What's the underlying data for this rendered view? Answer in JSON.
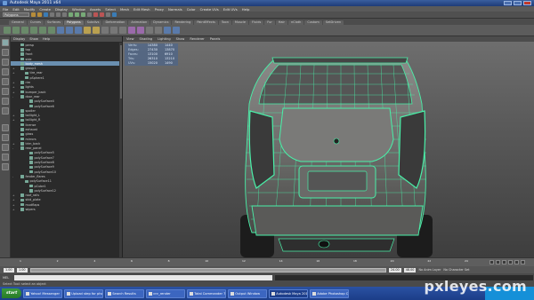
{
  "window": {
    "title": "Autodesk Maya 2011 x64"
  },
  "menubar": {
    "items": [
      "File",
      "Edit",
      "Modify",
      "Create",
      "Display",
      "Window",
      "Assets",
      "Select",
      "Mesh",
      "Edit Mesh",
      "Proxy",
      "Normals",
      "Color",
      "Create UVs",
      "Edit UVs",
      "Help"
    ]
  },
  "statusline": {
    "mode": "Polygons"
  },
  "shelf": {
    "tabs": [
      "General",
      "Curves",
      "Surfaces",
      "Polygons",
      "Subdivs",
      "Deformation",
      "Animation",
      "Dynamics",
      "Rendering",
      "PaintEffects",
      "Toon",
      "Muscle",
      "Fluids",
      "Fur",
      "Hair",
      "nCloth",
      "Custom",
      "SetDriven"
    ],
    "active_tab": 3
  },
  "outliner": {
    "menu": [
      "Display",
      "Show",
      "Help"
    ],
    "rows": [
      {
        "label": "persp",
        "indent": 1,
        "expand": ""
      },
      {
        "label": "top",
        "indent": 1,
        "expand": ""
      },
      {
        "label": "front",
        "indent": 1,
        "expand": ""
      },
      {
        "label": "side",
        "indent": 1,
        "expand": ""
      },
      {
        "label": "body_mesh",
        "indent": 1,
        "expand": "",
        "selected": true
      },
      {
        "label": "group1",
        "indent": 1,
        "expand": "+"
      },
      {
        "label": "tire_rear",
        "indent": 2,
        "expand": "+"
      },
      {
        "label": "pSphere1",
        "indent": 2,
        "expand": ""
      },
      {
        "label": "rim",
        "indent": 1,
        "expand": "+"
      },
      {
        "label": "lights",
        "indent": 1,
        "expand": "+"
      },
      {
        "label": "bumper_back",
        "indent": 1,
        "expand": "+"
      },
      {
        "label": "door_rear",
        "indent": 1,
        "expand": "-"
      },
      {
        "label": "polySurface4",
        "indent": 3,
        "expand": ""
      },
      {
        "label": "polySurface6",
        "indent": 3,
        "expand": ""
      },
      {
        "label": "spoiler",
        "indent": 1,
        "expand": ""
      },
      {
        "label": "taillight_L",
        "indent": 1,
        "expand": "+"
      },
      {
        "label": "taillight_R",
        "indent": 1,
        "expand": "+"
      },
      {
        "label": "license",
        "indent": 1,
        "expand": ""
      },
      {
        "label": "exhaust",
        "indent": 1,
        "expand": ""
      },
      {
        "label": "glass",
        "indent": 1,
        "expand": ""
      },
      {
        "label": "mirrors",
        "indent": 1,
        "expand": ""
      },
      {
        "label": "trim_back",
        "indent": 1,
        "expand": "+"
      },
      {
        "label": "rear_panel",
        "indent": 1,
        "expand": "-"
      },
      {
        "label": "polySurface5",
        "indent": 3,
        "expand": ""
      },
      {
        "label": "polySurface7",
        "indent": 3,
        "expand": ""
      },
      {
        "label": "polySurface8",
        "indent": 3,
        "expand": ""
      },
      {
        "label": "polySurface9",
        "indent": 3,
        "expand": ""
      },
      {
        "label": "polySurface10",
        "indent": 3,
        "expand": ""
      },
      {
        "label": "fender_flares",
        "indent": 1,
        "expand": "-"
      },
      {
        "label": "polySurface11",
        "indent": 2,
        "expand": ""
      },
      {
        "label": "pCube1",
        "indent": 3,
        "expand": ""
      },
      {
        "label": "polySurface12",
        "indent": 3,
        "expand": ""
      },
      {
        "label": "roof_rails",
        "indent": 1,
        "expand": "+"
      },
      {
        "label": "skid_plate",
        "indent": 1,
        "expand": "+"
      },
      {
        "label": "mudflaps",
        "indent": 1,
        "expand": "+"
      },
      {
        "label": "wipers",
        "indent": 1,
        "expand": "+"
      }
    ]
  },
  "viewport": {
    "menu": [
      "View",
      "Shading",
      "Lighting",
      "Show",
      "Renderer",
      "Panels"
    ],
    "hud": [
      {
        "label": "Verts:",
        "a": "14380",
        "b": "1440"
      },
      {
        "label": "Edges:",
        "a": "27430",
        "b": "13870"
      },
      {
        "label": "Faces:",
        "a": "13100",
        "b": "6910"
      },
      {
        "label": "Tris:",
        "a": "26310",
        "b": "13210"
      },
      {
        "label": "UVs:",
        "a": "15020",
        "b": "1490"
      }
    ],
    "wire_color": "#49f0a8"
  },
  "timeline": {
    "frames": [
      "1",
      "2",
      "4",
      "6",
      "8",
      "10",
      "12",
      "14",
      "16",
      "18",
      "20",
      "22",
      "24"
    ],
    "current": "1.00"
  },
  "range": {
    "start": "1.00",
    "start_anim": "1.00",
    "end": "24.00",
    "end_anim": "48.00",
    "anim_layer": "No Anim Layer",
    "char_set": "No Character Set"
  },
  "cmdline": {
    "mel_label": "MEL"
  },
  "helpline": {
    "text": "Select Tool: select an object"
  },
  "taskbar": {
    "start": "start",
    "tasks": [
      "Yahoo! Messenger",
      "Upload step for photosh...",
      "Search Results",
      "cnr_render",
      "Total Commander 7.0 ...",
      "Output Window",
      "Autodesk Maya 2011 ...",
      "Adobe Photoshop CS4 ..."
    ],
    "active_task": 6
  },
  "watermark": "pxleyes.com"
}
